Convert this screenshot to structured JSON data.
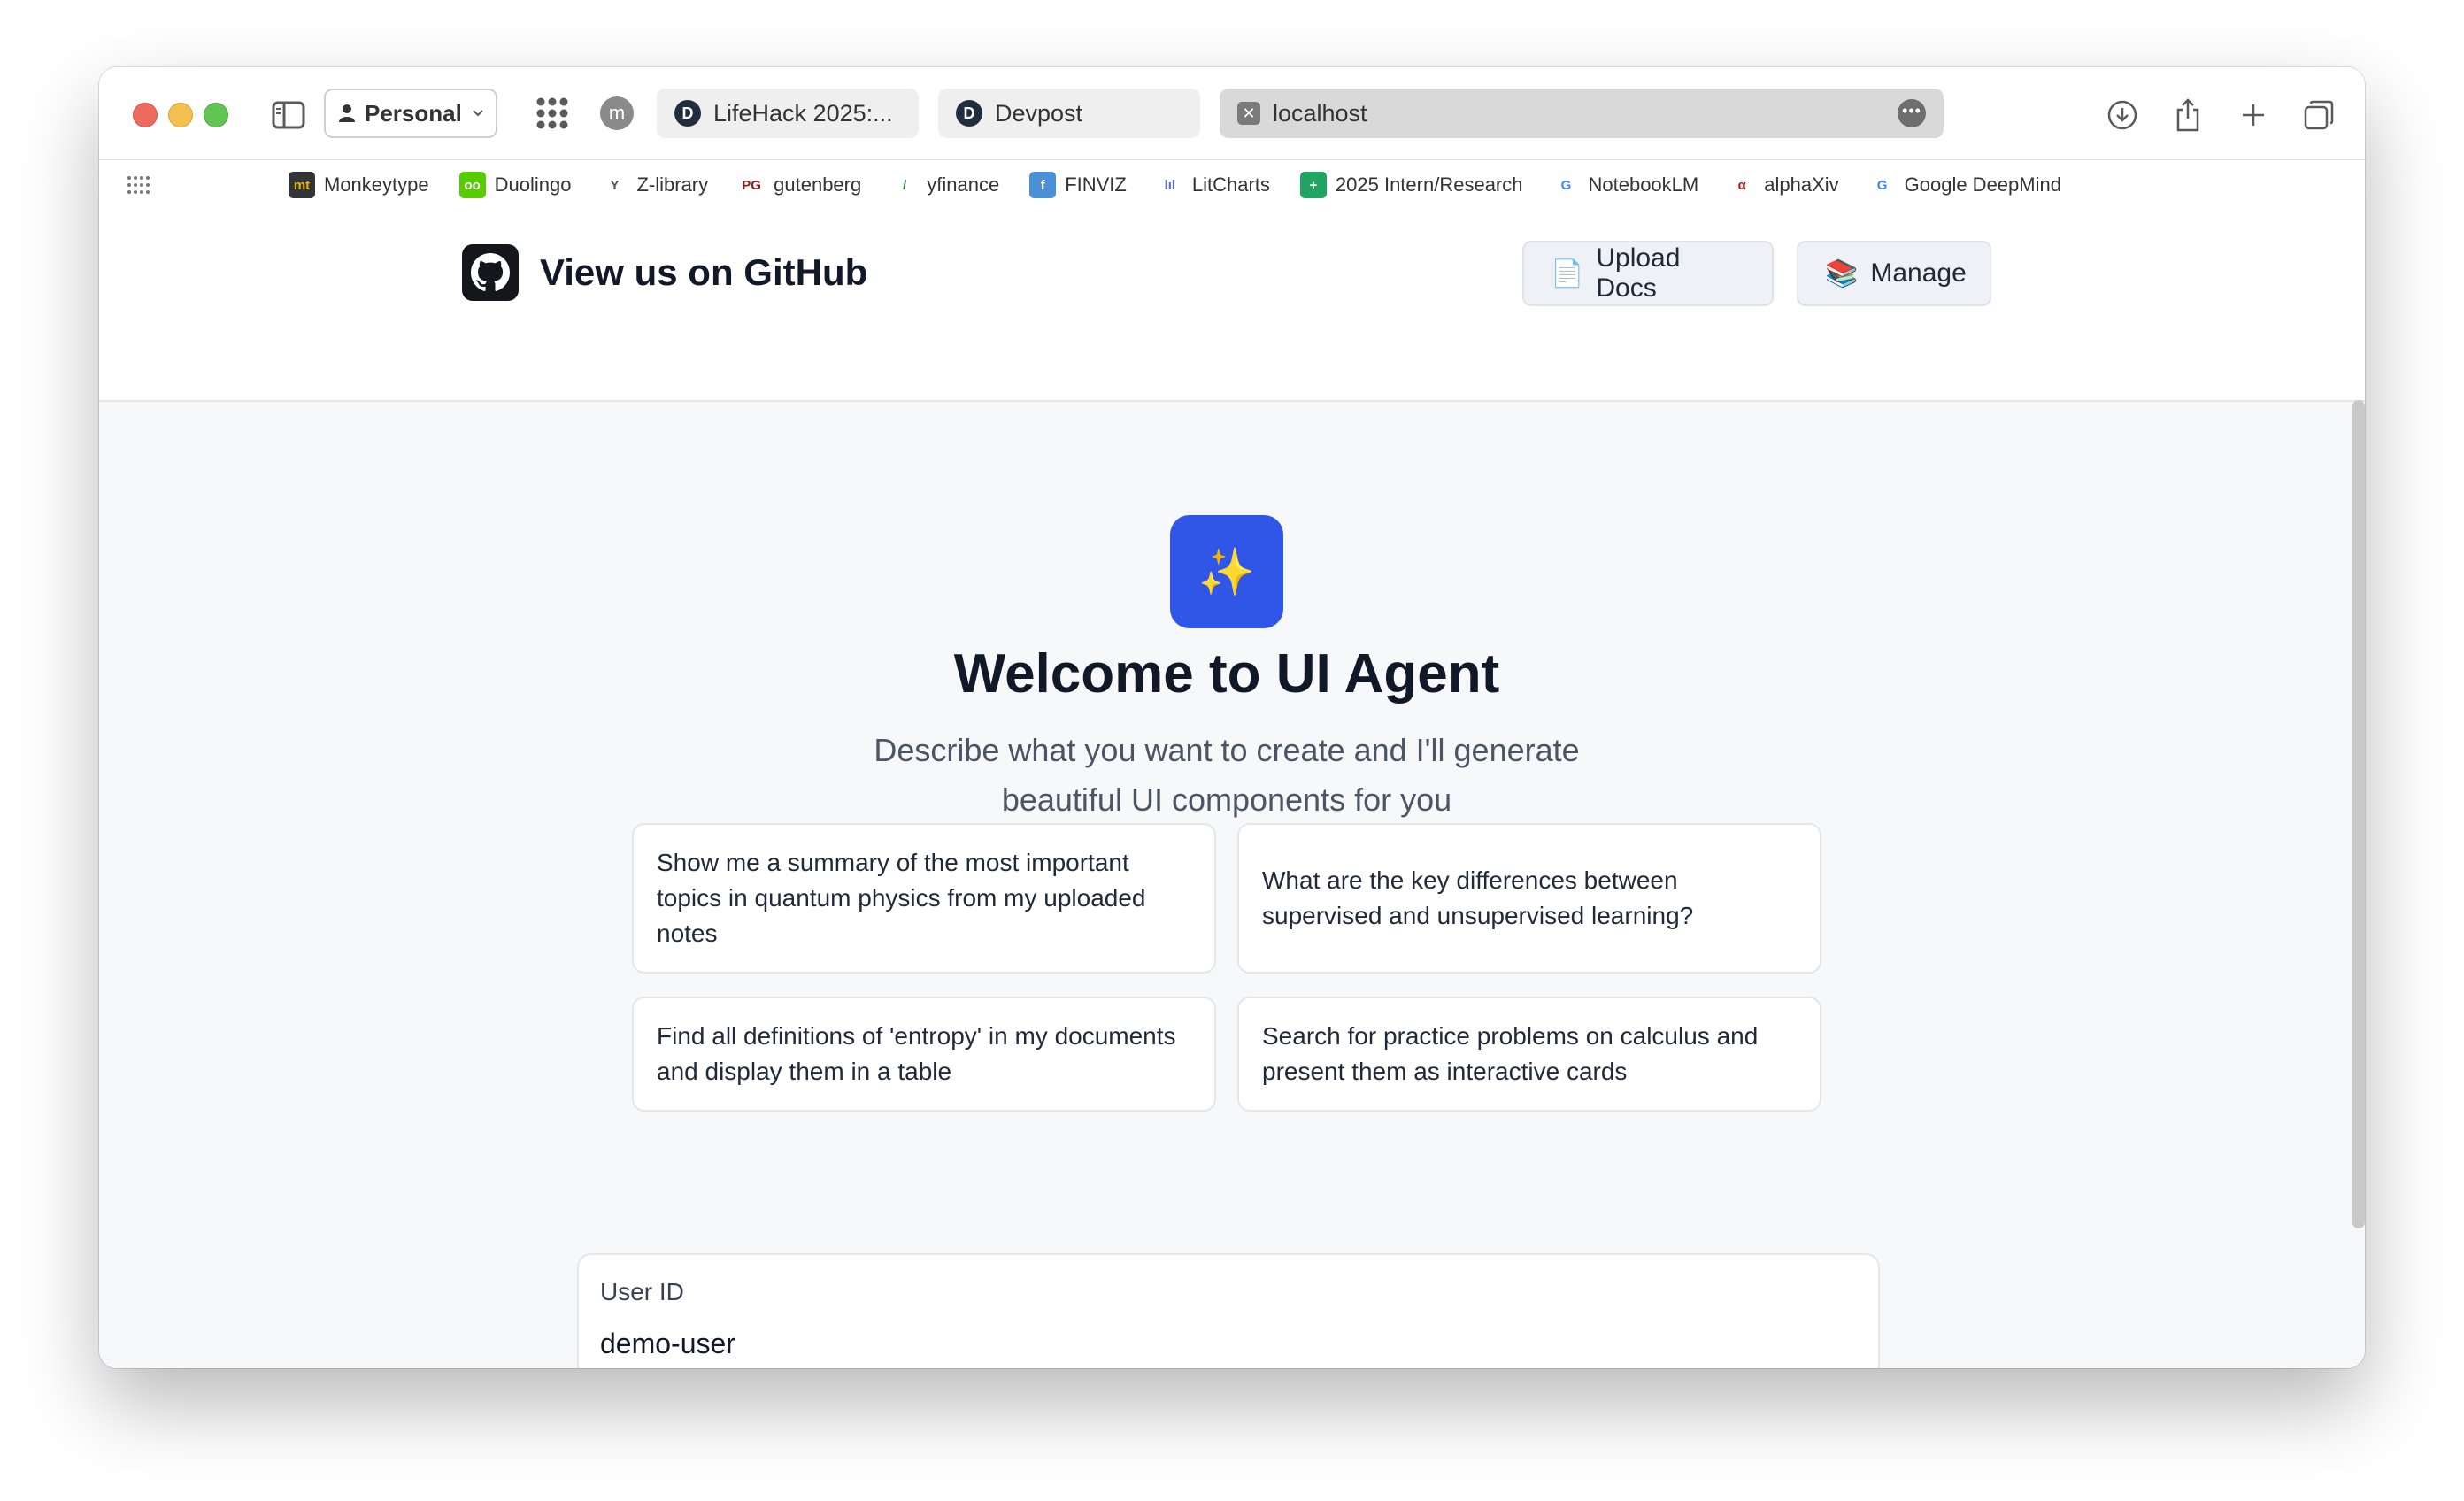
{
  "browser": {
    "profile_label": "Personal",
    "avatar_letter": "m",
    "tabs": [
      {
        "label": "LifeHack 2025:..."
      },
      {
        "label": "Devpost"
      },
      {
        "label": "localhost"
      }
    ],
    "tab_logo_letter": "D"
  },
  "bookmarks": [
    {
      "label": "Monkeytype",
      "icon_text": "mt",
      "color": "#323437",
      "fg": "#e2b714"
    },
    {
      "label": "Duolingo",
      "icon_text": "oo",
      "color": "#58cc02",
      "fg": "#ffffff"
    },
    {
      "label": "Z-library",
      "icon_text": "Y",
      "color": "#ffffff",
      "fg": "#555555"
    },
    {
      "label": "gutenberg",
      "icon_text": "PG",
      "color": "#ffffff",
      "fg": "#8b1a1a"
    },
    {
      "label": "yfinance",
      "icon_text": "/",
      "color": "#ffffff",
      "fg": "#2e7d32"
    },
    {
      "label": "FINVIZ",
      "icon_text": "f",
      "color": "#4a90d9",
      "fg": "#ffffff"
    },
    {
      "label": "LitCharts",
      "icon_text": "lıl",
      "color": "#ffffff",
      "fg": "#5b6bd5"
    },
    {
      "label": "2025 Intern/Research",
      "icon_text": "+",
      "color": "#1fa463",
      "fg": "#ffffff"
    },
    {
      "label": "NotebookLM",
      "icon_text": "G",
      "color": "#ffffff",
      "fg": "#4285f4"
    },
    {
      "label": "alphaXiv",
      "icon_text": "α",
      "color": "#ffffff",
      "fg": "#b31b1b"
    },
    {
      "label": "Google DeepMind",
      "icon_text": "G",
      "color": "#ffffff",
      "fg": "#4285f4"
    }
  ],
  "header": {
    "github_label": "View us on GitHub",
    "upload_label": "Upload Docs",
    "upload_icon": "📄",
    "manage_label": "Manage",
    "manage_icon": "📚"
  },
  "hero": {
    "icon": "✨",
    "title": "Welcome to UI Agent",
    "subtitle": "Describe what you want to create and I'll generate beautiful UI components for you"
  },
  "suggestions": [
    "Show me a summary of the most important topics in quantum physics from my uploaded notes",
    "What are the key differences between supervised and unsupervised learning?",
    "Find all definitions of 'entropy' in my documents and display them in a table",
    "Search for practice problems on calculus and present them as interactive cards"
  ],
  "user": {
    "label": "User ID",
    "value": "demo-user"
  },
  "colors": {
    "accent": "#3056e8",
    "page_bg": "#f7f8fa"
  }
}
